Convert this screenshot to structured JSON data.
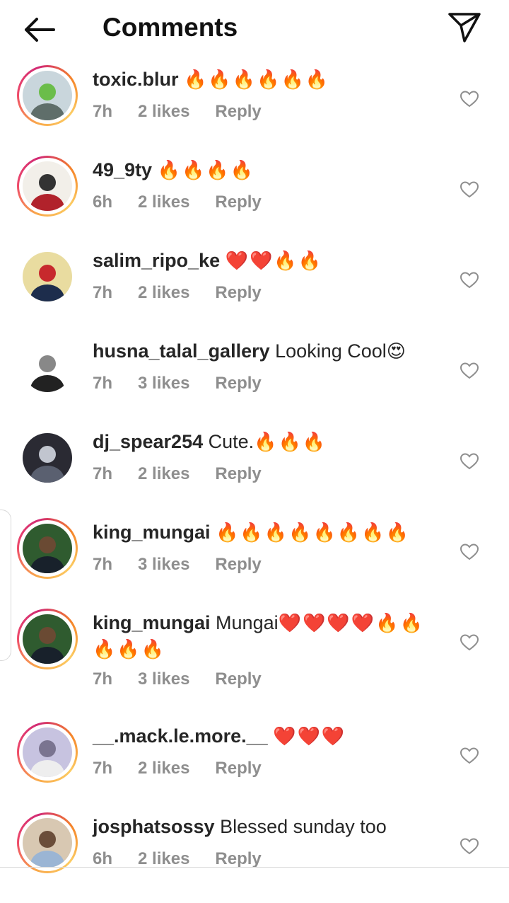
{
  "header": {
    "title": "Comments",
    "back_icon": "arrow-left-icon",
    "share_icon": "paper-plane-icon"
  },
  "comments": [
    {
      "user": "toxic.blur",
      "text": "",
      "emoji": "🔥🔥🔥🔥🔥🔥",
      "time": "7h",
      "likes": "2 likes",
      "reply": "Reply",
      "ring": true,
      "avatar_colors": [
        "#c9d6dc",
        "#5f6e6a",
        "#6bbd4a"
      ]
    },
    {
      "user": "49_9ty",
      "text": "",
      "emoji": "🔥🔥🔥🔥",
      "time": "6h",
      "likes": "2 likes",
      "reply": "Reply",
      "ring": true,
      "avatar_colors": [
        "#f2efe9",
        "#b1222b",
        "#333333"
      ]
    },
    {
      "user": "salim_ripo_ke",
      "text": "",
      "emoji": "❤️❤️🔥🔥",
      "time": "7h",
      "likes": "2 likes",
      "reply": "Reply",
      "ring": false,
      "avatar_colors": [
        "#e9dca0",
        "#1d2d4c",
        "#c7292d"
      ]
    },
    {
      "user": "husna_talal_gallery",
      "text": "Looking Cool",
      "emoji": "😍",
      "time": "7h",
      "likes": "3 likes",
      "reply": "Reply",
      "ring": false,
      "avatar_colors": [
        "#ffffff",
        "#222222",
        "#888888"
      ]
    },
    {
      "user": "dj_spear254",
      "text": "Cute.",
      "emoji": "🔥🔥🔥",
      "time": "7h",
      "likes": "2 likes",
      "reply": "Reply",
      "ring": false,
      "avatar_colors": [
        "#2a2a33",
        "#5a6070",
        "#c1c5cf"
      ]
    },
    {
      "user": "king_mungai",
      "text": "",
      "emoji": "🔥🔥🔥🔥🔥🔥🔥🔥",
      "time": "7h",
      "likes": "3 likes",
      "reply": "Reply",
      "ring": true,
      "avatar_colors": [
        "#2f5b2f",
        "#18212b",
        "#6a4a33"
      ]
    },
    {
      "user": "king_mungai",
      "text": "Mungai",
      "emoji": "❤️❤️❤️❤️🔥🔥",
      "emoji_line2": "🔥🔥🔥",
      "time": "7h",
      "likes": "3 likes",
      "reply": "Reply",
      "ring": true,
      "avatar_colors": [
        "#2f5b2f",
        "#18212b",
        "#6a4a33"
      ]
    },
    {
      "user": "__.mack.le.more.__",
      "text": "",
      "emoji": "❤️❤️❤️",
      "time": "7h",
      "likes": "2 likes",
      "reply": "Reply",
      "ring": true,
      "avatar_colors": [
        "#c7c3e0",
        "#eeeeee",
        "#7a7490"
      ]
    },
    {
      "user": "josphatsossy",
      "text": "Blessed sunday too",
      "emoji": "",
      "time": "6h",
      "likes": "2 likes",
      "reply": "Reply",
      "ring": true,
      "avatar_colors": [
        "#d8c8b2",
        "#9bb5d4",
        "#6b4e3a"
      ]
    }
  ]
}
